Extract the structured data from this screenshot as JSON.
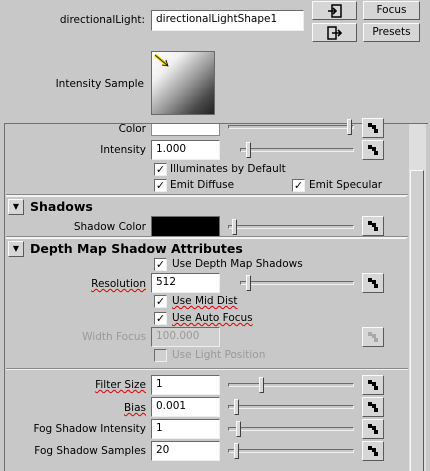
{
  "top": {
    "node_label": "directionalLight:",
    "node_value": "directionalLightShape1",
    "focus_label": "Focus",
    "presets_label": "Presets",
    "intensity_sample_label": "Intensity Sample"
  },
  "light": {
    "color_label": "Color",
    "intensity_label": "Intensity",
    "intensity_value": "1.000",
    "illuminates_label": "Illuminates by Default",
    "emit_diffuse_label": "Emit Diffuse",
    "emit_specular_label": "Emit Specular"
  },
  "shadows": {
    "section_title": "Shadows",
    "shadow_color_label": "Shadow Color"
  },
  "depth_map": {
    "section_title": "Depth Map Shadow Attributes",
    "use_dm_label": "Use Depth Map Shadows",
    "resolution_label": "Resolution",
    "resolution_value": "512",
    "use_mid_dist_label": "Use Mid Dist",
    "use_auto_focus_label": "Use Auto Focus",
    "width_focus_label": "Width Focus",
    "width_focus_value": "100.000",
    "use_light_position_label": "Use Light Position",
    "filter_size_label": "Filter Size",
    "filter_size_value": "1",
    "bias_label": "Bias",
    "bias_value": "0.001",
    "fog_intensity_label": "Fog Shadow Intensity",
    "fog_intensity_value": "1",
    "fog_samples_label": "Fog Shadow Samples",
    "fog_samples_value": "20"
  },
  "checkmark": "✓",
  "colors": {
    "background": "#c8c8c8",
    "shadow_color": "#000000"
  }
}
